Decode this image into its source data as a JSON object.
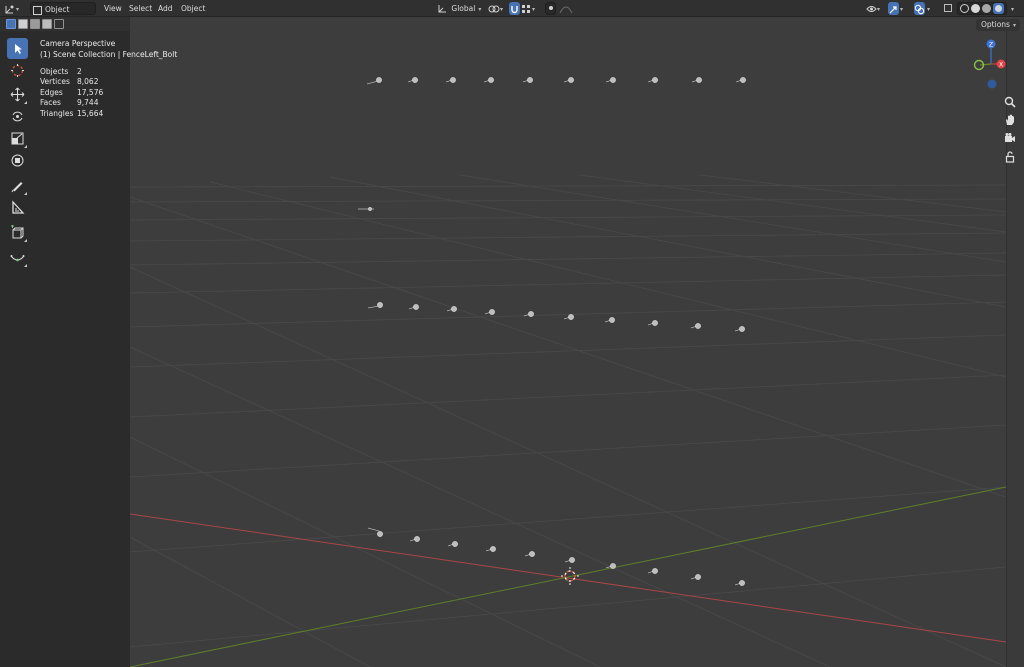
{
  "header": {
    "editor_type_icon": "view3d-icon",
    "mode_label": "Object Mode",
    "menus": [
      "View",
      "Select",
      "Add",
      "Object"
    ],
    "transform_orientation": "Global",
    "options_label": "Options"
  },
  "overlay": {
    "view_name": "Camera Perspective",
    "collection_line": "(1) Scene Collection | FenceLeft_Bolt",
    "stats": [
      {
        "label": "Objects",
        "value": "2"
      },
      {
        "label": "Vertices",
        "value": "8,062"
      },
      {
        "label": "Edges",
        "value": "17,576"
      },
      {
        "label": "Faces",
        "value": "9,744"
      },
      {
        "label": "Triangles",
        "value": "15,664"
      }
    ]
  },
  "gizmo": {
    "axis_z": "Z",
    "axis_x": "X"
  },
  "toolbar": {
    "tools": [
      "select-box-icon",
      "cursor-icon",
      "move-icon",
      "rotate-icon",
      "scale-icon",
      "transform-icon",
      "annotate-icon",
      "measure-icon",
      "add-cube-icon",
      "curve-icon"
    ]
  },
  "colors": {
    "viewport": "#3d3d3d",
    "grid": "#4a4a4a",
    "x_axis": "#b34a4a",
    "y_axis": "#6b8e23",
    "accent": "#4772b3"
  }
}
